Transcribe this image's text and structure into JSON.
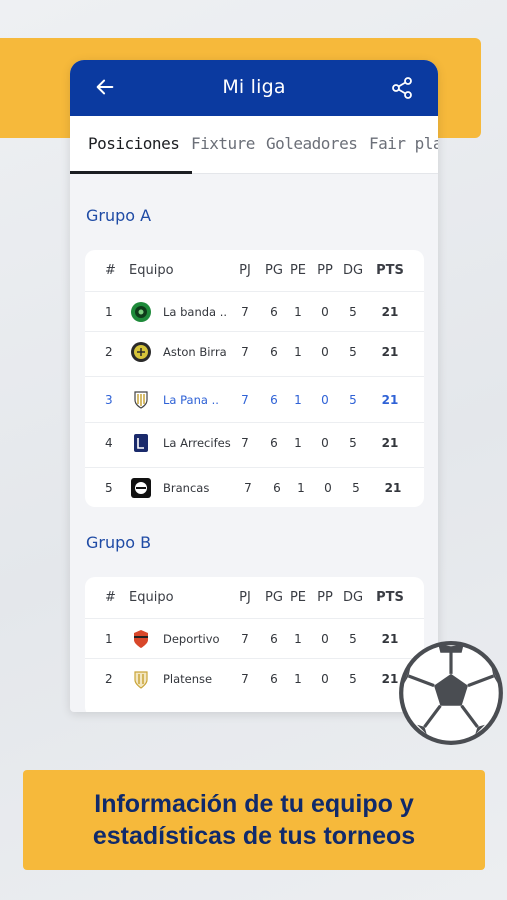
{
  "app": {
    "title": "Mi liga",
    "back_icon": "arrow-left-icon",
    "share_icon": "share-icon",
    "accent": "#0b3aa0",
    "brand_yellow": "#f6b93b"
  },
  "tabs": [
    {
      "label": "Posiciones",
      "active": true
    },
    {
      "label": "Fixture"
    },
    {
      "label": "Goleadores"
    },
    {
      "label": "Fair play"
    }
  ],
  "columns": {
    "pos": "#",
    "team": "Equipo",
    "pj": "PJ",
    "pg": "PG",
    "pe": "PE",
    "pp": "PP",
    "dg": "DG",
    "pts": "PTS"
  },
  "group_a": {
    "title": "Grupo A",
    "rows": [
      {
        "pos": "1",
        "team": "La banda ..",
        "pj": "7",
        "pg": "6",
        "pe": "1",
        "pp": "0",
        "dg": "5",
        "pts": "21"
      },
      {
        "pos": "2",
        "team": "Aston Birra",
        "pj": "7",
        "pg": "6",
        "pe": "1",
        "pp": "0",
        "dg": "5",
        "pts": "21"
      },
      {
        "pos": "3",
        "team": "La Pana ..",
        "pj": "7",
        "pg": "6",
        "pe": "1",
        "pp": "0",
        "dg": "5",
        "pts": "21"
      },
      {
        "pos": "4",
        "team": "La Arrecifes",
        "pj": "7",
        "pg": "6",
        "pe": "1",
        "pp": "0",
        "dg": "5",
        "pts": "21"
      },
      {
        "pos": "5",
        "team": "Brancas",
        "pj": "7",
        "pg": "6",
        "pe": "1",
        "pp": "0",
        "dg": "5",
        "pts": "21"
      }
    ]
  },
  "group_b": {
    "title": "Grupo B",
    "rows": [
      {
        "pos": "1",
        "team": "Deportivo",
        "pj": "7",
        "pg": "6",
        "pe": "1",
        "pp": "0",
        "dg": "5",
        "pts": "21"
      },
      {
        "pos": "2",
        "team": "Platense",
        "pj": "7",
        "pg": "6",
        "pe": "1",
        "pp": "0",
        "dg": "5",
        "pts": "21"
      }
    ]
  },
  "banner": {
    "line1": "Información de tu equipo y",
    "line2": "estadísticas de tus torneos"
  }
}
